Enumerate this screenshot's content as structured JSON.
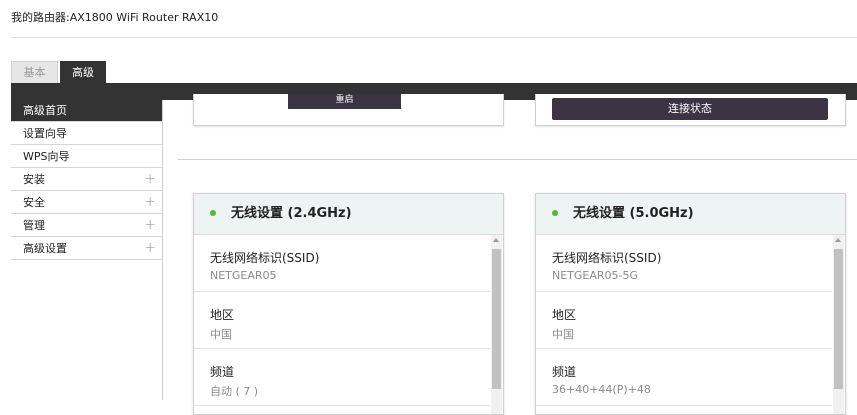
{
  "header": {
    "title": "我的路由器:AX1800 WiFi Router RAX10"
  },
  "tabs": {
    "basic": "基本",
    "advanced": "高级"
  },
  "sidebar": {
    "items": [
      {
        "label": "高级首页",
        "active": true,
        "expandable": false
      },
      {
        "label": "设置向导",
        "active": false,
        "expandable": false
      },
      {
        "label": "WPS向导",
        "active": false,
        "expandable": false
      },
      {
        "label": "安装",
        "active": false,
        "expandable": true
      },
      {
        "label": "安全",
        "active": false,
        "expandable": true
      },
      {
        "label": "管理",
        "active": false,
        "expandable": true
      },
      {
        "label": "高级设置",
        "active": false,
        "expandable": true
      }
    ],
    "expand_glyph": "+"
  },
  "top_panels": {
    "left_button_label": "重启",
    "right_button_label": "连接状态"
  },
  "wireless": [
    {
      "title": "无线设置 (2.4GHz)",
      "status_color": "#56b82c",
      "fields": [
        {
          "label": "无线网络标识(SSID)",
          "value": "NETGEAR05"
        },
        {
          "label": "地区",
          "value": "中国"
        },
        {
          "label": "频道",
          "value": "自动 ( 7 )"
        }
      ]
    },
    {
      "title": "无线设置 (5.0GHz)",
      "status_color": "#56b82c",
      "fields": [
        {
          "label": "无线网络标识(SSID)",
          "value": "NETGEAR05-5G"
        },
        {
          "label": "地区",
          "value": "中国"
        },
        {
          "label": "频道",
          "value": "36+40+44(P)+48"
        }
      ]
    }
  ]
}
